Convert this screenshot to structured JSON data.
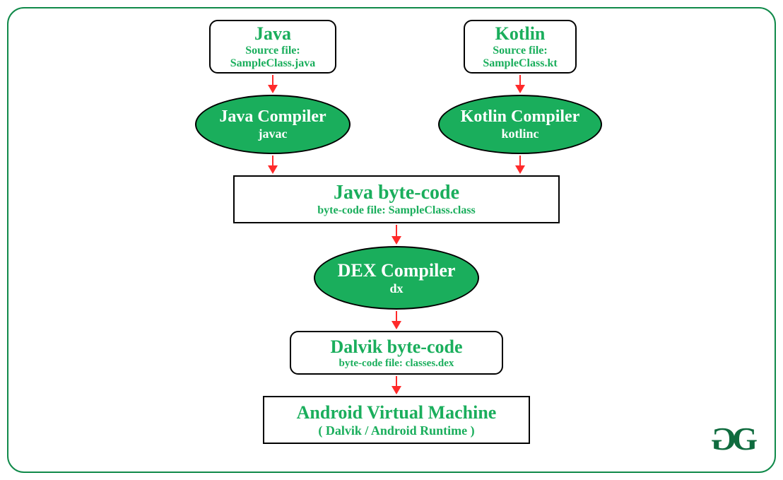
{
  "nodes": {
    "java_src": {
      "title": "Java",
      "line1": "Source file:",
      "line2": "SampleClass.java"
    },
    "kotlin_src": {
      "title": "Kotlin",
      "line1": "Source file:",
      "line2": "SampleClass.kt"
    },
    "java_comp": {
      "title": "Java Compiler",
      "sub": "javac"
    },
    "kotlin_comp": {
      "title": "Kotlin Compiler",
      "sub": "kotlinc"
    },
    "java_bc": {
      "title": "Java byte-code",
      "sub": "byte-code file: SampleClass.class"
    },
    "dex_comp": {
      "title": "DEX Compiler",
      "sub": "dx"
    },
    "dalvik_bc": {
      "title": "Dalvik byte-code",
      "sub": "byte-code file: classes.dex"
    },
    "avm": {
      "title": "Android Virtual Machine",
      "sub": "( Dalvik / Android Runtime )"
    }
  },
  "logo": {
    "char1": "G",
    "char2": "G"
  }
}
